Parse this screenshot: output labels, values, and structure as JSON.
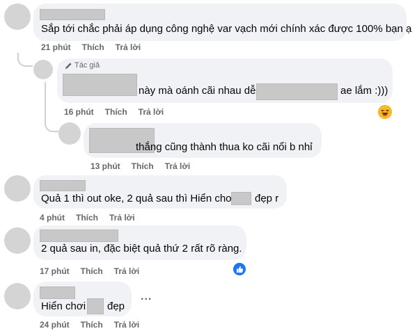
{
  "comments": [
    {
      "text": "Sắp tới chắc phải áp dụng công nghệ var vạch mới chính xác được 100% bạn ạ",
      "time": "21 phút",
      "like": "Thích",
      "reply": "Trả lời"
    },
    {
      "author_badge": "Tác giả",
      "text_a": "này mà oánh cãi nhau dễ",
      "text_b": "ae lắm :)))",
      "time": "16 phút",
      "like": "Thích",
      "reply": "Trả lời",
      "reaction_icon": "haha-emoji-icon"
    },
    {
      "text": "thắng cũng thành thua ko cãi nổi b nhỉ",
      "time": "13 phút",
      "like": "Thích",
      "reply": "Trả lời"
    },
    {
      "text_a": "Quả 1 thì out oke, 2 quả sau thì Hiển chơi",
      "text_b": "đẹp r",
      "time": "4 phút",
      "like": "Thích",
      "reply": "Trả lời"
    },
    {
      "text": "2 quả sau in, đặc biệt quả thứ 2 rất rõ ràng.",
      "time": "17 phút",
      "like": "Thích",
      "reply": "Trả lời",
      "reaction_icon": "like-thumb-icon"
    },
    {
      "text_a": "Hiển chơi",
      "text_b": "đẹp",
      "time": "24 phút",
      "like": "Thích",
      "reply": "Trả lời",
      "more_label": "..."
    }
  ],
  "colors": {
    "bubble": "#f0f2f5",
    "meta": "#65676b",
    "like_blue": "#1877f2",
    "haha_yellow": "#f7b928"
  }
}
